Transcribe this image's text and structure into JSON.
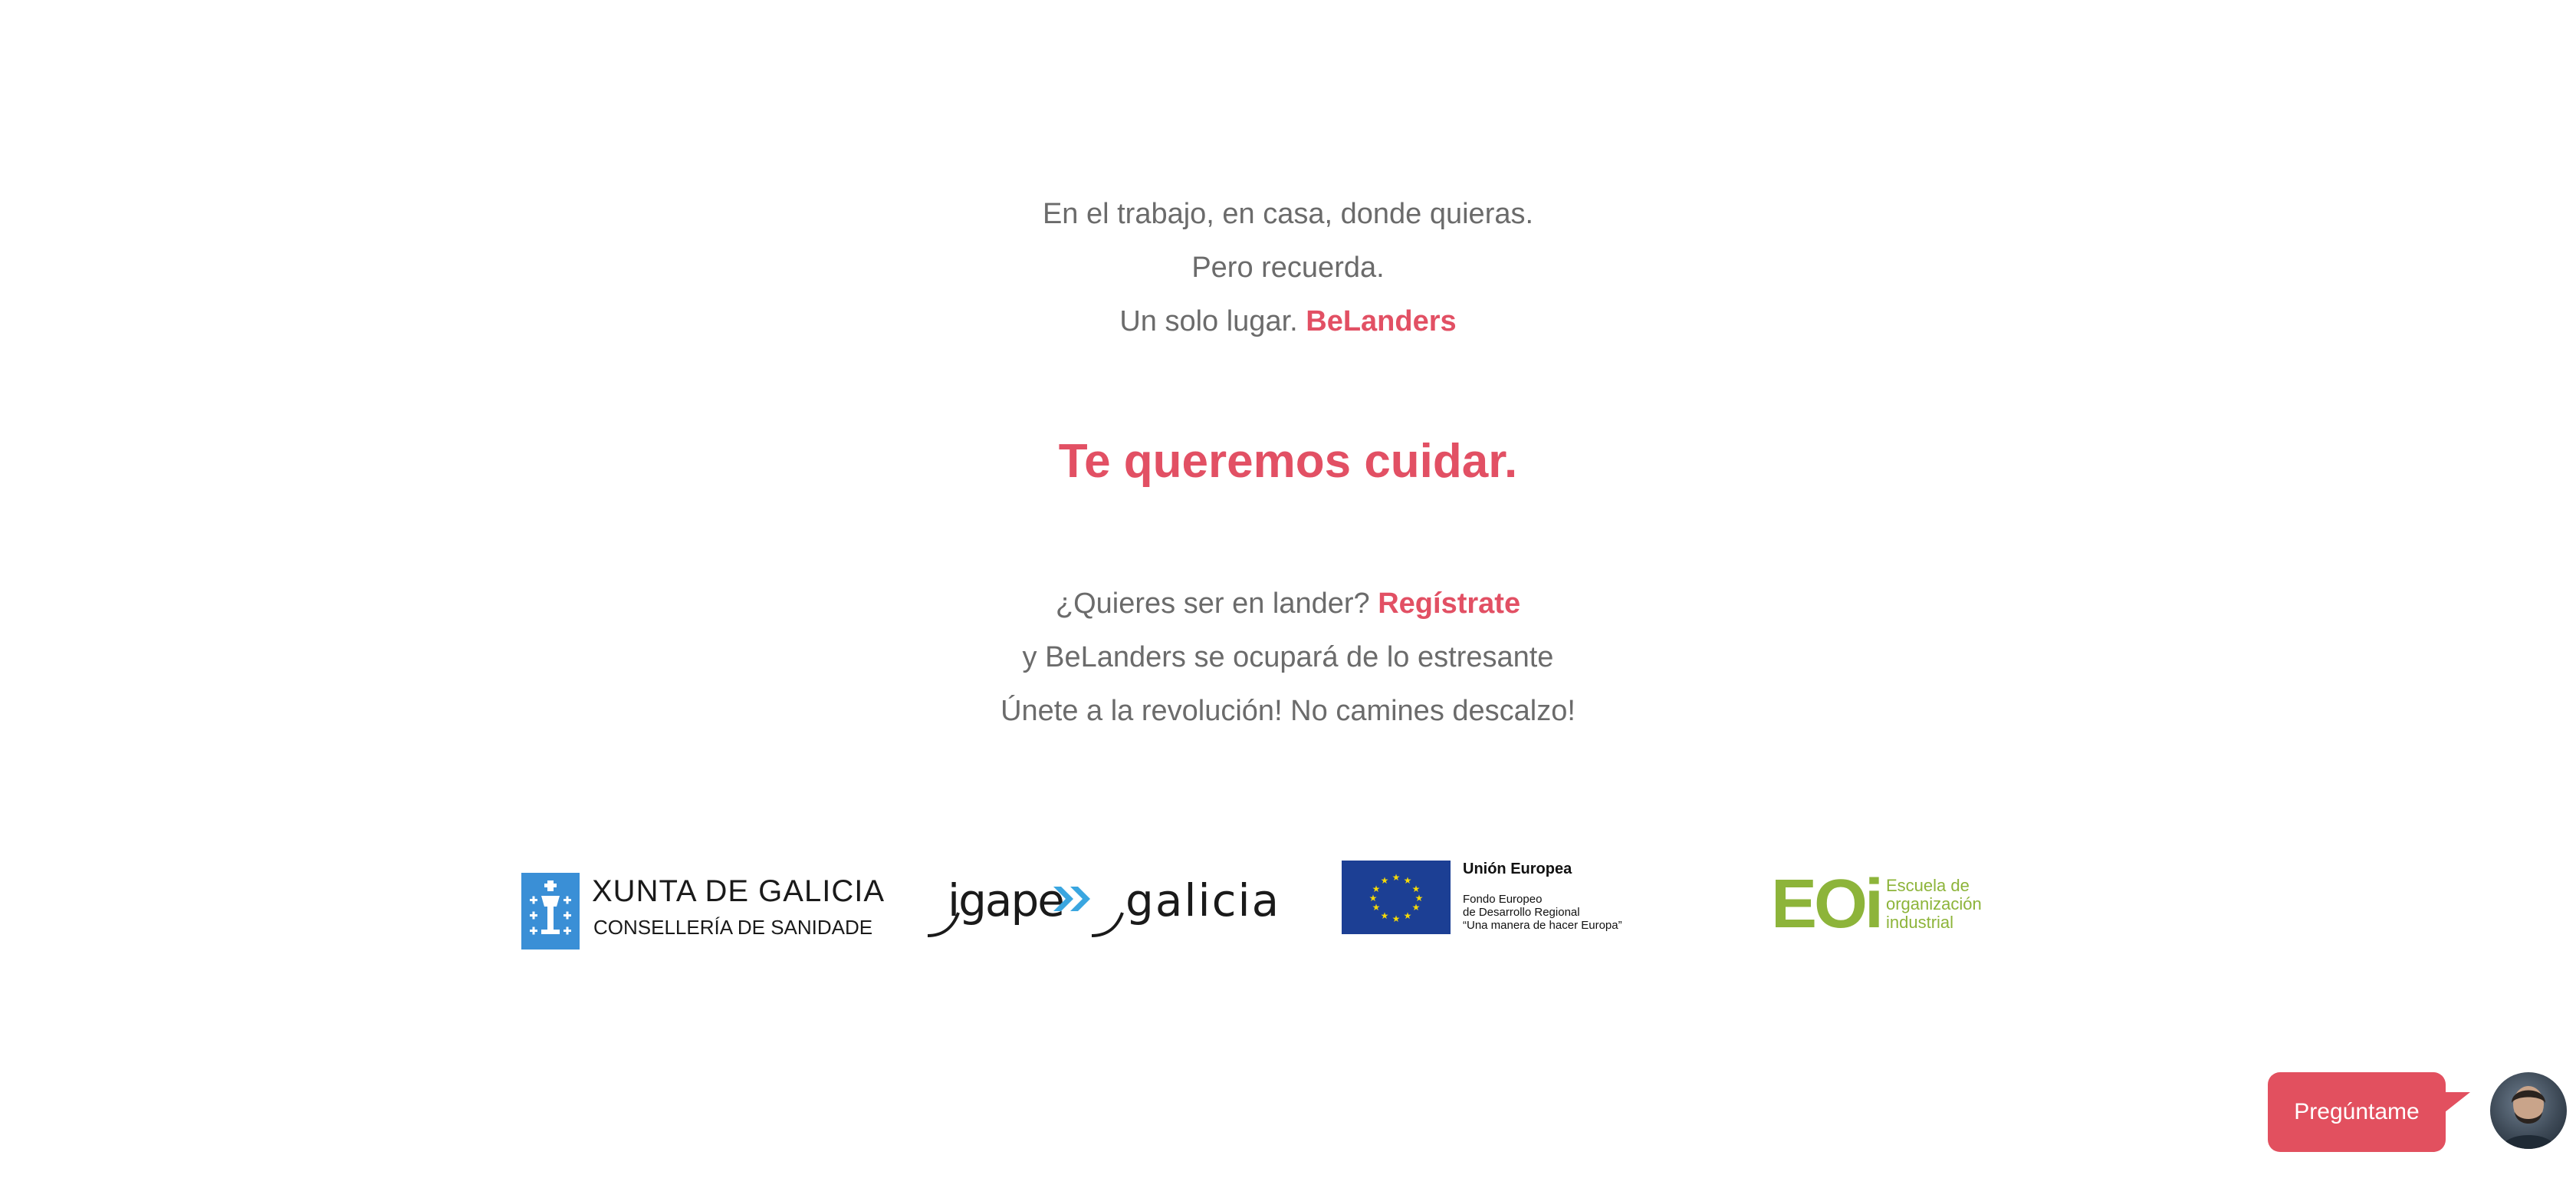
{
  "intro": {
    "line1": "En el trabajo, en casa, donde quieras.",
    "line2": "Pero recuerda.",
    "line3_prefix": "Un solo lugar. ",
    "line3_brand": "BeLanders"
  },
  "headline": "Te queremos cuidar.",
  "join": {
    "line1_prefix": "¿Quieres ser en lander? ",
    "register_link": "Regístrate",
    "line2": "y BeLanders se ocupará de lo estresante",
    "line3": "Únete a la revolución! No camines descalzo!"
  },
  "logos": {
    "xunta": {
      "title": "XUNTA DE GALICIA",
      "subtitle": "CONSELLERÍA DE SANIDADE"
    },
    "igape": {
      "word1": "igape",
      "word2": "galicia"
    },
    "eu": {
      "title": "Unión Europea",
      "line1": "Fondo Europeo",
      "line2": "de Desarrollo Regional",
      "line3": "“Una manera de hacer Europa”"
    },
    "eoi": {
      "mark": "EOi",
      "line1": "Escuela de",
      "line2": "organización",
      "line3": "industrial"
    }
  },
  "chat": {
    "label": "Pregúntame"
  },
  "colors": {
    "accent": "#e25064",
    "text": "#6b6b6b",
    "eu_blue": "#1c3f94",
    "eu_star": "#f4d90a",
    "eoi_green": "#8db43a",
    "xunta_blue": "#3a8fd6"
  }
}
